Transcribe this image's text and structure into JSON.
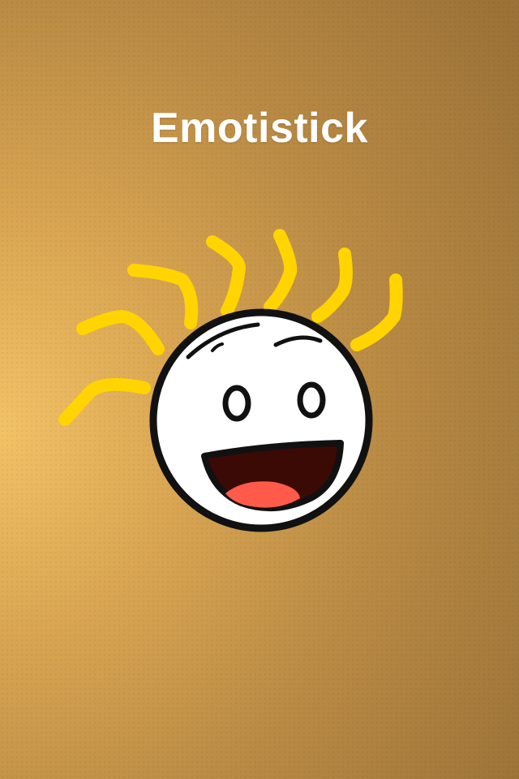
{
  "app": {
    "title": "Emotistick"
  },
  "mascot": {
    "icon": "happy-face-with-sun-rays-icon",
    "colors": {
      "rays": "#ffd400",
      "face": "#ffffff",
      "outline": "#111111",
      "mouth": "#3b0a05",
      "tongue": "#ff5a4a"
    }
  },
  "theme": {
    "background_light": "#f2c266",
    "background_dark": "#9c7237"
  }
}
